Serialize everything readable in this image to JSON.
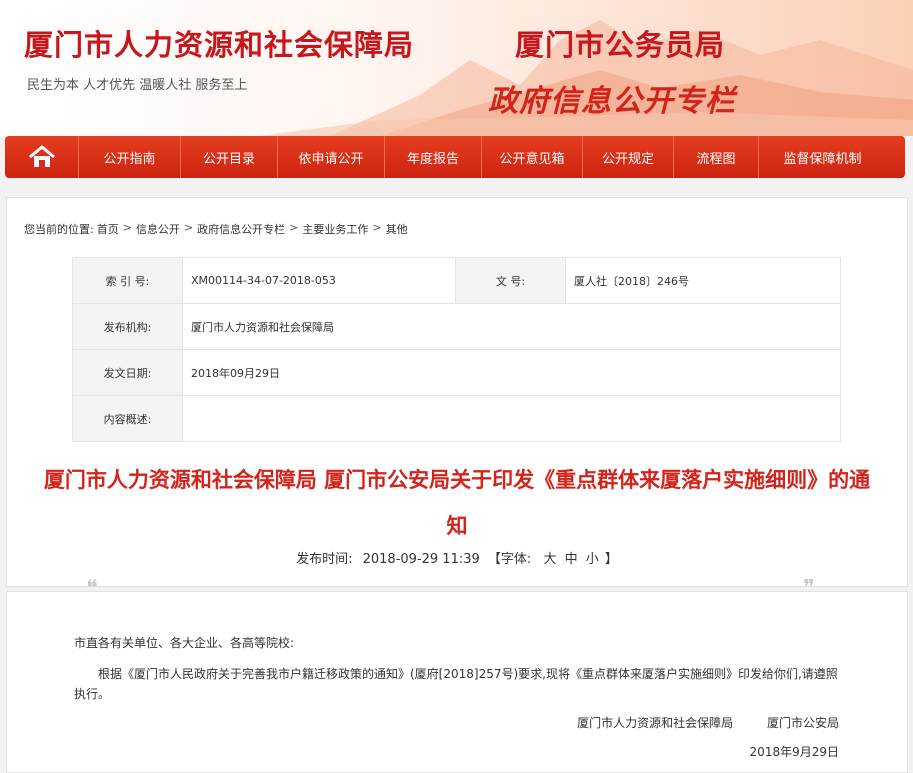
{
  "banner": {
    "org_title_1": "厦门市人力资源和社会保障局",
    "org_title_2": "厦门市公务员局",
    "slogan": "民生为本  人才优先  温暖人社  服务至上",
    "column_title": "政府信息公开专栏"
  },
  "nav": {
    "home_icon": "home-icon",
    "items": [
      "公开指南",
      "公开目录",
      "依申请公开",
      "年度报告",
      "公开意见箱",
      "公开规定",
      "流程图",
      "监督保障机制"
    ]
  },
  "breadcrumb": {
    "prefix": "您当前的位置:",
    "items": [
      "首页",
      "信息公开",
      "政府信息公开专栏",
      "主要业务工作",
      "其他"
    ],
    "separator": ">"
  },
  "meta": {
    "index_label": "索 引 号:",
    "index_value": "XM00114-34-07-2018-053",
    "docno_label": "文    号:",
    "docno_value": "厦人社〔2018〕246号",
    "publisher_label": "发布机构:",
    "publisher_value": "厦门市人力资源和社会保障局",
    "date_label": "发文日期:",
    "date_value": "2018年09月29日",
    "summary_label": "内容概述:",
    "summary_value": ""
  },
  "document": {
    "title": "厦门市人力资源和社会保障局 厦门市公安局关于印发《重点群体来厦落户实施细则》的通知",
    "pub_label": "发布时间:",
    "pub_time": "2018-09-29 11:39",
    "font_label": "【字体:",
    "font_large": "大",
    "font_medium": "中",
    "font_small": "小",
    "font_close": "】",
    "salutation": "市直各有关单位、各大企业、各高等院校:",
    "paragraph": "根据《厦门市人民政府关于完善我市户籍迁移政策的通知》(厦府[2018]257号)要求,现将《重点群体来厦落户实施细则》印发给你们,请遵照执行。",
    "signer_1": "厦门市人力资源和社会保障局",
    "signer_2": "厦门市公安局",
    "sign_date": "2018年9月29日"
  },
  "colors": {
    "brand_red": "#c8161d",
    "nav_red": "#d9301a",
    "title_red": "#d4231a"
  }
}
